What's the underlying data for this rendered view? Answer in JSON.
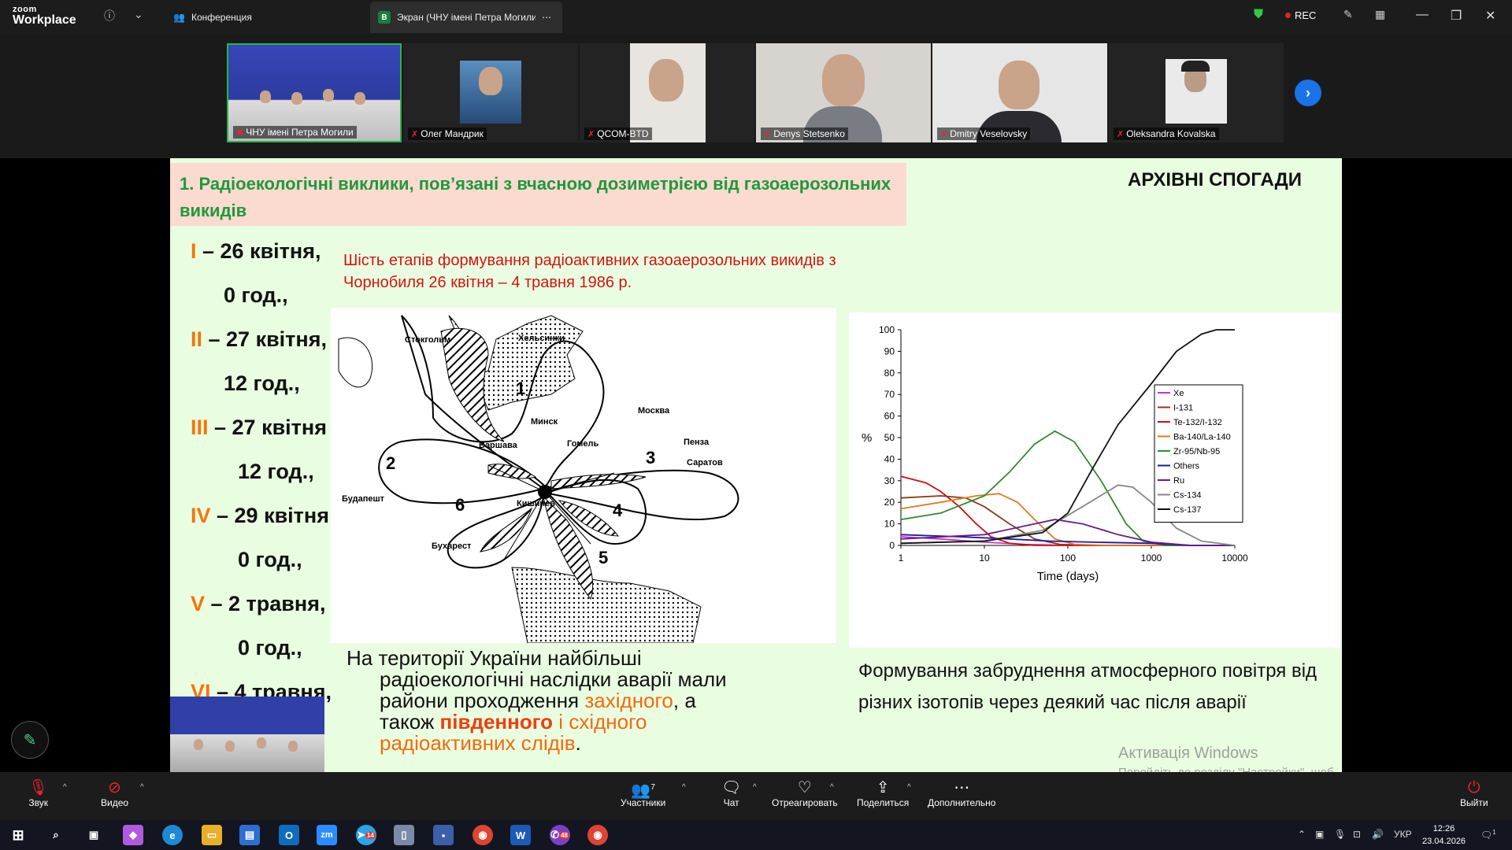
{
  "app": {
    "brand_top": "zoom",
    "brand_bottom": "Workplace"
  },
  "tabs": [
    {
      "label": "Конференция"
    },
    {
      "label": "Экран (ЧНУ імені Петра Могили",
      "badge": "B"
    }
  ],
  "top_right": {
    "rec_label": "REC"
  },
  "participants": [
    {
      "name": "ЧНУ імені Петра Могили"
    },
    {
      "name": "Олег Мандрик"
    },
    {
      "name": "QCOM-BTD"
    },
    {
      "name": "Denys Stetsenko"
    },
    {
      "name": "Dmitry Veselovsky"
    },
    {
      "name": "Oleksandra Kovalska"
    }
  ],
  "slide": {
    "header": "1. Радіоекологічні виклики, пов’язані з вчасною дозиметрією  від газоаерозольних викидів",
    "archive": "АРХІВНІ СПОГАДИ",
    "stages": [
      {
        "num": "I",
        "text": " – 26 квітня,"
      },
      {
        "num": "",
        "text": "0 год.,"
      },
      {
        "num": "II",
        "text": " – 27 квітня,"
      },
      {
        "num": "",
        "text": "12 год.,"
      },
      {
        "num": "III",
        "text": " – 27 квітня"
      },
      {
        "num": "",
        "text": "12 год.,"
      },
      {
        "num": "IV",
        "text": " – 29 квітня"
      },
      {
        "num": "",
        "text": "0 год.,"
      },
      {
        "num": "V",
        "text": " – 2 травня,"
      },
      {
        "num": "",
        "text": "0 год.,"
      },
      {
        "num": "VI",
        "text": " – 4 травня,"
      }
    ],
    "six_stages": "Шість етапів формування радіоактивних газоаерозольних викидів з Чорнобиля 26 квітня – 4 травня 1986 р.",
    "map_labels": [
      "Стокгольм",
      "Хельсинки",
      "Москва",
      "Минск",
      "Варшава",
      "Гомель",
      "Пенза",
      "Саратов",
      "Будапешт",
      "Кишинев",
      "Бухарест",
      "1",
      "2",
      "3",
      "4",
      "5",
      "6"
    ],
    "ukraine_text": {
      "l1": "На території України найбільші",
      "l2": "радіоекологічні наслідки аварії мали",
      "l3a": "райони проходження ",
      "l3b": "західного",
      "l3c": ", а",
      "l4a": "також ",
      "l4b": "південного",
      "l4c": " і ",
      "l4d": "східного",
      "l5a": "радіоактивних слідів",
      "l5b": "."
    },
    "formation": "Формування забруднення атмосферного повітря від різних ізотопів через деякий час після аварії"
  },
  "chart_data": {
    "type": "line",
    "xlabel": "Time (days)",
    "ylabel": "%",
    "xscale": "log",
    "xlim": [
      1,
      10000
    ],
    "ylim": [
      0,
      100
    ],
    "xticks": [
      "1",
      "10",
      "100",
      "1000",
      "10000"
    ],
    "yticks": [
      "0",
      "10",
      "20",
      "30",
      "40",
      "50",
      "60",
      "70",
      "80",
      "90",
      "100"
    ],
    "legend_position": "right",
    "series": [
      {
        "name": "Xe",
        "color": "#cc33cc",
        "points": [
          [
            1,
            4
          ],
          [
            3,
            3
          ],
          [
            10,
            1.5
          ],
          [
            30,
            0.5
          ],
          [
            100,
            0
          ],
          [
            10000,
            0
          ]
        ]
      },
      {
        "name": "I-131",
        "color": "#8b3a1a",
        "points": [
          [
            1,
            22
          ],
          [
            3,
            23
          ],
          [
            6,
            22
          ],
          [
            10,
            18
          ],
          [
            20,
            10
          ],
          [
            40,
            3
          ],
          [
            80,
            0.5
          ],
          [
            200,
            0
          ],
          [
            10000,
            0
          ]
        ]
      },
      {
        "name": "Te-132/I-132",
        "color": "#cc1111",
        "points": [
          [
            1,
            32
          ],
          [
            2,
            29
          ],
          [
            3,
            25
          ],
          [
            5,
            18
          ],
          [
            8,
            10
          ],
          [
            12,
            4
          ],
          [
            20,
            1
          ],
          [
            40,
            0
          ],
          [
            10000,
            0
          ]
        ]
      },
      {
        "name": "Ba-140/La-140",
        "color": "#e07b1a",
        "points": [
          [
            1,
            17
          ],
          [
            3,
            20
          ],
          [
            8,
            23
          ],
          [
            15,
            24
          ],
          [
            25,
            20
          ],
          [
            40,
            12
          ],
          [
            70,
            3
          ],
          [
            120,
            0.5
          ],
          [
            300,
            0
          ],
          [
            10000,
            0
          ]
        ]
      },
      {
        "name": "Zr-95/Nb-95",
        "color": "#2e8b2e",
        "points": [
          [
            1,
            12
          ],
          [
            3,
            15
          ],
          [
            10,
            23
          ],
          [
            20,
            34
          ],
          [
            40,
            47
          ],
          [
            70,
            53
          ],
          [
            120,
            48
          ],
          [
            250,
            30
          ],
          [
            500,
            10
          ],
          [
            800,
            2
          ],
          [
            1500,
            0
          ],
          [
            10000,
            0
          ]
        ]
      },
      {
        "name": "Others",
        "color": "#1a1aaa",
        "points": [
          [
            1,
            5
          ],
          [
            5,
            4
          ],
          [
            20,
            3
          ],
          [
            60,
            2
          ],
          [
            200,
            1.5
          ],
          [
            1000,
            1
          ],
          [
            3000,
            0
          ],
          [
            10000,
            0
          ]
        ]
      },
      {
        "name": "Ru",
        "color": "#6a1a8a",
        "points": [
          [
            1,
            3
          ],
          [
            10,
            5
          ],
          [
            40,
            10
          ],
          [
            70,
            12
          ],
          [
            150,
            10
          ],
          [
            400,
            5
          ],
          [
            1000,
            1.5
          ],
          [
            3000,
            0
          ],
          [
            10000,
            0
          ]
        ]
      },
      {
        "name": "Cs-134",
        "color": "#888888",
        "points": [
          [
            1,
            1
          ],
          [
            10,
            2
          ],
          [
            50,
            7
          ],
          [
            150,
            18
          ],
          [
            400,
            28
          ],
          [
            600,
            27
          ],
          [
            1000,
            20
          ],
          [
            2000,
            8
          ],
          [
            4000,
            2
          ],
          [
            10000,
            0
          ]
        ]
      },
      {
        "name": "Cs-137",
        "color": "#111111",
        "points": [
          [
            1,
            1
          ],
          [
            10,
            2
          ],
          [
            50,
            6
          ],
          [
            100,
            15
          ],
          [
            200,
            36
          ],
          [
            400,
            56
          ],
          [
            1000,
            75
          ],
          [
            2000,
            90
          ],
          [
            4000,
            98
          ],
          [
            6000,
            100
          ],
          [
            10000,
            100
          ]
        ]
      }
    ]
  },
  "watermark": {
    "line1": "Активація Windows",
    "line2": "Перейдіть до розділу \"Настройки\", щоб активувати Windows."
  },
  "toolbar": {
    "sound": "Звук",
    "video": "Видео",
    "participants": "Участники",
    "participants_count": "7",
    "chat": "Чат",
    "react": "Отреагировать",
    "share": "Поделиться",
    "more": "Дополнительно",
    "leave": "Выйти"
  },
  "taskbar": {
    "lang": "УКР",
    "time": "12:26",
    "date": "23.04.2026",
    "telegram_badge": "14",
    "viber_badge": "48",
    "notif_count": "1"
  }
}
